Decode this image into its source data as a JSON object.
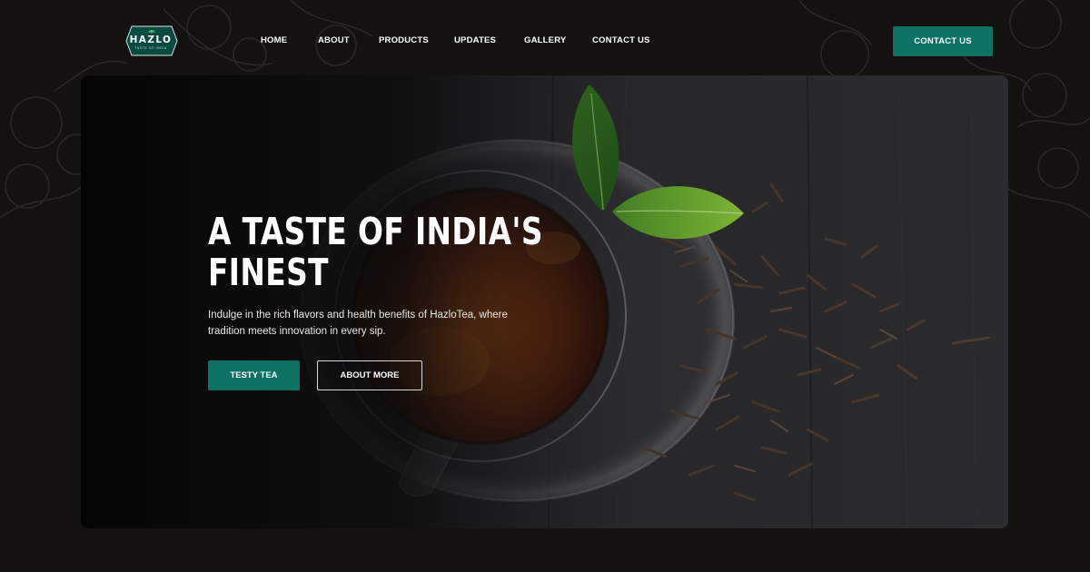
{
  "brand": {
    "logo_text": "HAZLO",
    "logo_subtext": "TASTE OF INDIA",
    "accent_color": "#0c7264"
  },
  "nav": {
    "items": [
      {
        "label": "HOME"
      },
      {
        "label": "ABOUT"
      },
      {
        "label": "PRODUCTS"
      },
      {
        "label": "UPDATES"
      },
      {
        "label": "GALLERY"
      },
      {
        "label": "CONTACT US"
      }
    ]
  },
  "header": {
    "cta_label": "CONTACT US"
  },
  "hero": {
    "title_line1": "A TASTE OF INDIA'S",
    "title_line2": "FINEST",
    "description": "Indulge in the rich flavors and health benefits of HazloTea, where tradition meets innovation in every sip.",
    "primary_button": "TESTY TEA",
    "secondary_button": "ABOUT MORE",
    "image_icon": "tea-cup-with-leaves-image"
  }
}
